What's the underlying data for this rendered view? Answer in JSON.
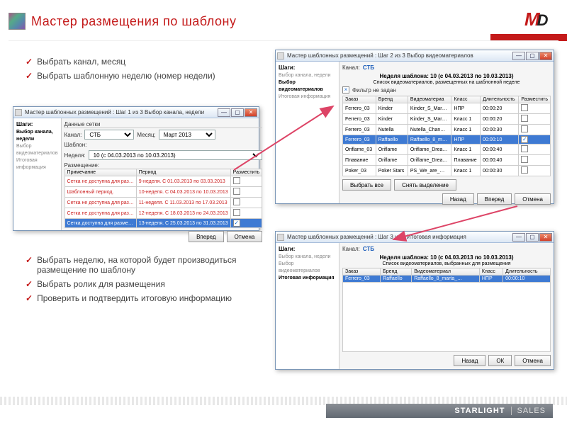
{
  "page": {
    "title": "Мастер размещения по шаблону",
    "logo_m": "M",
    "logo_d": "D",
    "footer_brand": "STARLIGHT",
    "footer_unit": "SALES"
  },
  "bullets_top": [
    "Выбрать канал, месяц",
    "Выбрать шаблонную неделю (номер недели)"
  ],
  "bullets_bottom": [
    "Выбрать неделю, на которой будет производиться размещение по шаблону",
    "Выбрать ролик для размещения",
    "Проверить и подтвердить итоговую информацию"
  ],
  "win1": {
    "title": "Мастер шаблонных размещений : Шаг 1 из 3 Выбор канала, недели",
    "steps_title": "Шаги:",
    "steps": [
      "Выбор канала, недели",
      "Выбор видеоматериалов",
      "Итоговая информация"
    ],
    "current_step": 0,
    "group_label": "Данные сетки",
    "channel_label": "Канал:",
    "channel_value": "СТБ",
    "month_label": "Месяц:",
    "month_value": "Март 2013",
    "template_label": "Шаблон:",
    "week_label": "Неделя:",
    "week_value": "10 (с 04.03.2013 по 10.03.2013)",
    "placement_label": "Размещение:",
    "columns": [
      "Примечание",
      "Период",
      "Разместить"
    ],
    "rows": [
      {
        "note": "Сетка не доступна для раз…",
        "period": "9-неделя. С 01.03.2013 по 03.03.2013",
        "place": false,
        "red": true
      },
      {
        "note": "Шаблонный период.",
        "period": "10-неделя. С 04.03.2013 по 10.03.2013",
        "place": false,
        "red": true
      },
      {
        "note": "Сетка не доступна для раз…",
        "period": "11-неделя. С 11.03.2013 по 17.03.2013",
        "place": false,
        "red": true
      },
      {
        "note": "Сетка не доступна для раз…",
        "period": "12-неделя. С 18.03.2013 по 24.03.2013",
        "place": false,
        "red": true
      },
      {
        "note": "Сетка доступна для разме…",
        "period": "13-неделя. С 25.03.2013 по 31.03.2013",
        "place": true,
        "sel": true
      }
    ],
    "btn_next": "Вперед",
    "btn_cancel": "Отмена"
  },
  "win2": {
    "title": "Мастер шаблонных размещений : Шаг 2 из 3 Выбор видеоматериалов",
    "steps_title": "Шаги:",
    "steps": [
      "Выбор канала, недели",
      "Выбор видеоматериалов",
      "Итоговая информация"
    ],
    "current_step": 1,
    "channel_label": "Канал:",
    "channel_value": "СТБ",
    "week_caption": "Неделя шаблона:  10 (с 04.03.2013 по 10.03.2013)",
    "subcaption": "Список видеоматериалов, размещенных на шаблонной неделе",
    "filter_label": "Фильтр не задан",
    "columns": [
      "Заказ",
      "Бренд",
      "Видеоматериа",
      "Класс",
      "Длительность",
      "Разместить"
    ],
    "rows": [
      {
        "order": "Ferrero_03",
        "brand": "Kinder",
        "video": "Kinder_S_Mar…",
        "class": "НПР",
        "dur": "00:00:20",
        "place": false
      },
      {
        "order": "Ferrero_03",
        "brand": "Kinder",
        "video": "Kinder_S_Mar…",
        "class": "Класс 1",
        "dur": "00:00:20",
        "place": false
      },
      {
        "order": "Ferrero_03",
        "brand": "Nutella",
        "video": "Nutella_Chan…",
        "class": "Класс 1",
        "dur": "00:00:30",
        "place": false
      },
      {
        "order": "Ferrero_03",
        "brand": "Raffaello",
        "video": "Raffaello_8_m…",
        "class": "НПР",
        "dur": "00:00:10",
        "place": true,
        "sel": true
      },
      {
        "order": "Oriflame_03",
        "brand": "Oriflame",
        "video": "Oriflame_Drea…",
        "class": "Класс 1",
        "dur": "00:00:40",
        "place": false
      },
      {
        "order": "Плавание",
        "brand": "Oriflame",
        "video": "Oriflame_Drea…",
        "class": "Плавание",
        "dur": "00:00:40",
        "place": false
      },
      {
        "order": "Poker_03",
        "brand": "Poker Stars",
        "video": "PS_We_are_…",
        "class": "Класс 1",
        "dur": "00:00:30",
        "place": false
      }
    ],
    "btn_select_all": "Выбрать все",
    "btn_deselect": "Снять выделение",
    "btn_back": "Назад",
    "btn_next": "Вперед",
    "btn_cancel": "Отмена"
  },
  "win3": {
    "title": "Мастер шаблонных размещений : Шаг 3 из 3 Итоговая информация",
    "steps_title": "Шаги:",
    "steps": [
      "Выбор канала, недели",
      "Выбор видеоматериалов",
      "Итоговая информация"
    ],
    "current_step": 2,
    "channel_label": "Канал:",
    "channel_value": "СТБ",
    "week_caption": "Неделя шаблона:  10 (с 04.03.2013 по 10.03.2013)",
    "subcaption": "Список видеоматериалов, выбранных для размещения",
    "columns": [
      "Заказ",
      "Бренд",
      "Видеоматериал",
      "Класс",
      "Длительность"
    ],
    "rows": [
      {
        "order": "Ferrero_03",
        "brand": "Raffaello",
        "video": "Raffaello_8_marta_…",
        "class": "НПР",
        "dur": "00:00:10",
        "sel": true
      }
    ],
    "btn_back": "Назад",
    "btn_ok": "ОК",
    "btn_cancel": "Отмена"
  },
  "winctrl": {
    "min": "—",
    "max": "▢",
    "close": "✕"
  }
}
